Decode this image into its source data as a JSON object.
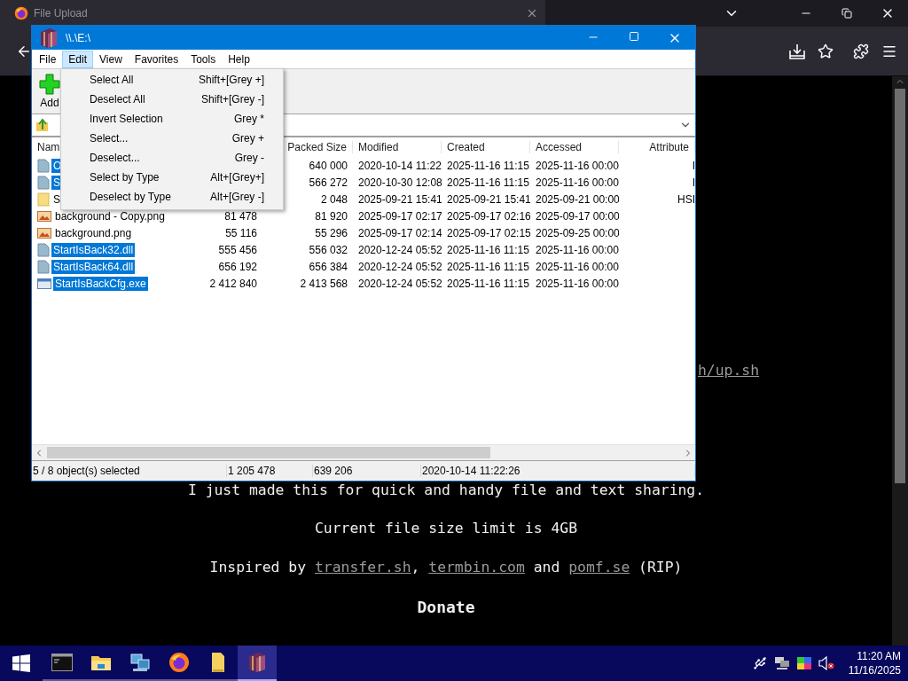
{
  "browser": {
    "tab": {
      "title": "File Upload"
    },
    "page": {
      "partial_link": "h/up.sh",
      "intro": "I just made this for quick and handy file and text sharing.",
      "limit": "Current file size limit is 4GB",
      "inspired": [
        {
          "kind": "text",
          "text": "Inspired by "
        },
        {
          "kind": "link",
          "text": "transfer.sh"
        },
        {
          "kind": "text",
          "text": ", "
        },
        {
          "kind": "link",
          "text": "termbin.com"
        },
        {
          "kind": "text",
          "text": " and "
        },
        {
          "kind": "link",
          "text": "pomf.se"
        },
        {
          "kind": "text",
          "text": " (RIP)"
        }
      ],
      "heading": "Donate"
    }
  },
  "archive_window": {
    "title": "\\\\.\\E:\\",
    "menu": [
      {
        "label": "File",
        "selected": false
      },
      {
        "label": "Edit",
        "selected": true
      },
      {
        "label": "View",
        "selected": false
      },
      {
        "label": "Favorites",
        "selected": false
      },
      {
        "label": "Tools",
        "selected": false
      },
      {
        "label": "Help",
        "selected": false
      }
    ],
    "toolbar": [
      {
        "label": "Add"
      }
    ],
    "columns": [
      "Nam",
      "Packed Size",
      "Modified",
      "Created",
      "Accessed",
      "Attribute"
    ],
    "rows": [
      {
        "kind": "file",
        "name": "O",
        "packed_size": "640 000",
        "modified": "2020-10-14 11:22",
        "created": "2025-11-16 11:15",
        "accessed": "2025-11-16 00:00",
        "attributes": "I",
        "selected": true
      },
      {
        "kind": "file",
        "name": "S",
        "packed_size": "566 272",
        "modified": "2020-10-30 12:08",
        "created": "2025-11-16 11:15",
        "accessed": "2025-11-16 00:00",
        "attributes": "I",
        "selected": true
      },
      {
        "kind": "folder",
        "name": "S",
        "packed_size": "2 048",
        "modified": "2025-09-21 15:41",
        "created": "2025-09-21 15:41",
        "accessed": "2025-09-21 00:00",
        "attributes": "HSI",
        "selected": false
      },
      {
        "kind": "image",
        "name": "background - Copy.png",
        "size": "81 478",
        "packed_size": "81 920",
        "modified": "2025-09-17 02:17",
        "created": "2025-09-17 02:16",
        "accessed": "2025-09-17 00:00",
        "selected": false
      },
      {
        "kind": "image",
        "name": "background.png",
        "size": "55 116",
        "packed_size": "55 296",
        "modified": "2025-09-17 02:14",
        "created": "2025-09-17 02:15",
        "accessed": "2025-09-25 00:00",
        "selected": false
      },
      {
        "kind": "file",
        "name": "StartIsBack32.dll",
        "size": "555 456",
        "packed_size": "556 032",
        "modified": "2020-12-24 05:52",
        "created": "2025-11-16 11:15",
        "accessed": "2025-11-16 00:00",
        "selected": true
      },
      {
        "kind": "file",
        "name": "StartIsBack64.dll",
        "size": "656 192",
        "packed_size": "656 384",
        "modified": "2020-12-24 05:52",
        "created": "2025-11-16 11:15",
        "accessed": "2025-11-16 00:00",
        "selected": true
      },
      {
        "kind": "exe",
        "name": "StartIsBackCfg.exe",
        "size": "2 412 840",
        "packed_size": "2 413 568",
        "modified": "2020-12-24 05:52",
        "created": "2025-11-16 11:15",
        "accessed": "2025-11-16 00:00",
        "selected": true
      }
    ],
    "status": [
      "5 / 8 object(s) selected",
      "1 205 478",
      "639 206",
      "2020-10-14 11:22:26"
    ]
  },
  "edit_menu": [
    {
      "label": "Select All",
      "shortcut": "Shift+[Grey +]"
    },
    {
      "label": "Deselect All",
      "shortcut": "Shift+[Grey -]"
    },
    {
      "label": "Invert Selection",
      "shortcut": "Grey *"
    },
    {
      "label": "Select...",
      "shortcut": "Grey +"
    },
    {
      "label": "Deselect...",
      "shortcut": "Grey -"
    },
    {
      "label": "Select by Type",
      "shortcut": "Alt+[Grey+]"
    },
    {
      "label": "Deselect by Type",
      "shortcut": "Alt+[Grey -]"
    }
  ],
  "taskbar": {
    "apps": [
      {
        "kind": "terminal",
        "active": false
      },
      {
        "kind": "explorer",
        "active": false
      },
      {
        "kind": "network",
        "active": false
      },
      {
        "kind": "browser",
        "active": false
      },
      {
        "kind": "folder",
        "active": false
      },
      {
        "kind": "archiver",
        "active": true
      }
    ],
    "clock": {
      "time": "11:20 AM",
      "date": "11/16/2025"
    }
  }
}
